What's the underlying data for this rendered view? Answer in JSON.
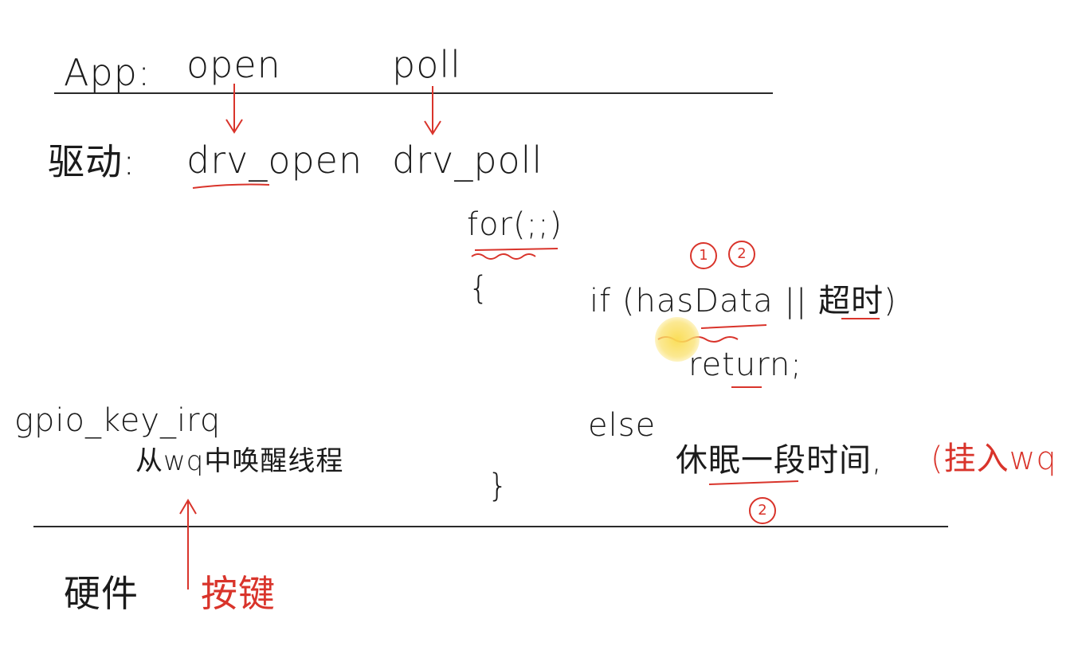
{
  "layers": {
    "app_label": "App:",
    "driver_label": "驱动:",
    "hardware_label": "硬件"
  },
  "app": {
    "open": "open",
    "poll": "poll"
  },
  "driver": {
    "drv_open": "drv_open",
    "drv_poll": "drv_poll",
    "for_loop": "for(;;)",
    "open_brace": "{",
    "close_brace": "}",
    "if_line": "if (hasData || 超时)",
    "return_line": "return;",
    "else_line": "else",
    "sleep_line": "休眠一段时间,",
    "sleep_note": "(挂入wq"
  },
  "irq": {
    "handler": "gpio_key_irq",
    "wake_text": "从wq中唤醒线程"
  },
  "hardware": {
    "button": "按键"
  },
  "markers": {
    "circle_1": "1",
    "circle_2_top": "2",
    "circle_2_bottom": "2"
  },
  "colors": {
    "ink": "#1b1b1b",
    "annotation_red": "#d9342b",
    "cursor_highlight": "#f7d84a"
  }
}
